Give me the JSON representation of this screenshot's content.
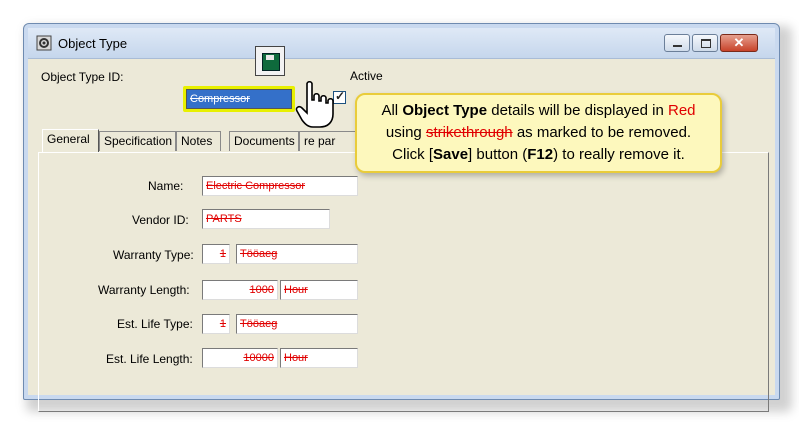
{
  "window": {
    "title": "Object Type"
  },
  "header": {
    "id_label": "Object Type ID:",
    "id_value": "Compressor",
    "active_label": "Active",
    "active_checked": true
  },
  "tabs": [
    "General",
    "Specification",
    "Notes",
    "Documents",
    "re par"
  ],
  "form": {
    "name_label": "Name:",
    "name_value": "Electric Compressor",
    "vendor_label": "Vendor ID:",
    "vendor_value": "PARTS",
    "warranty_type_label": "Warranty Type:",
    "warranty_type_code": "1",
    "warranty_type_name": "Tööaeg",
    "warranty_length_label": "Warranty Length:",
    "warranty_length_value": "1000",
    "warranty_length_unit": "Hour",
    "life_type_label": "Est. Life Type:",
    "life_type_code": "1",
    "life_type_name": "Tööaeg",
    "life_length_label": "Est. Life Length:",
    "life_length_value": "10000",
    "life_length_unit": "Hour"
  },
  "callout": {
    "line1_a": "All ",
    "line1_b": "Object Type",
    "line1_c": " details will be displayed in ",
    "line1_d": "Red",
    "line2_a": "using ",
    "line2_b": "strikethrough",
    "line2_c": " as marked to be removed.",
    "line3_a": "Click [",
    "line3_b": "Save",
    "line3_c": "] button (",
    "line3_d": "F12",
    "line3_e": ") to really remove it."
  },
  "colors": {
    "removed_text": "#e00000",
    "callout_bg": "#fdf8bd",
    "highlight": "#e8f000"
  }
}
